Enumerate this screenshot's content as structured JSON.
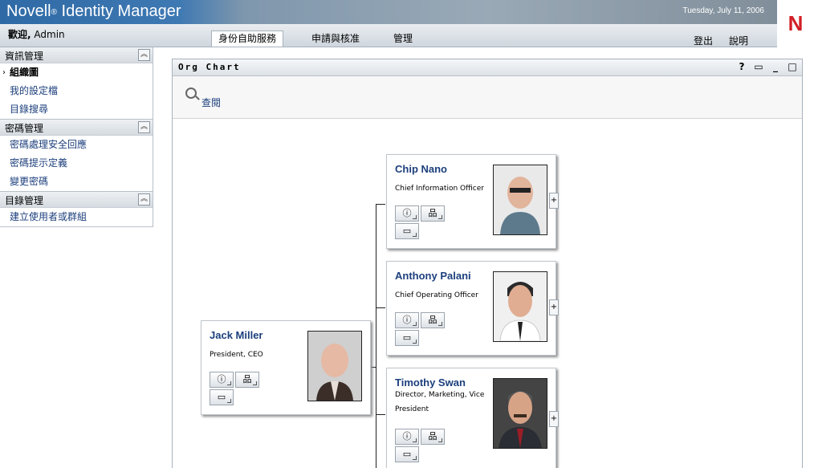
{
  "banner": {
    "brand": "Novell",
    "brand_mark": "®",
    "brand_rest": " Identity Manager",
    "date": "Tuesday, July 11, 2006",
    "logo": "N"
  },
  "header": {
    "welcome_prefix": "歡迎,",
    "welcome_user": "Admin",
    "tabs": [
      {
        "label": "身份自助服務",
        "active": true
      },
      {
        "label": "申請與核准"
      },
      {
        "label": "管理"
      }
    ],
    "logout": "登出",
    "help": "說明"
  },
  "sidebar": {
    "sections": [
      {
        "title": "資訊管理",
        "items": [
          {
            "label": "組織圖",
            "current": true
          },
          {
            "label": "我的設定檔"
          },
          {
            "label": "目錄搜尋"
          }
        ]
      },
      {
        "title": "密碼管理",
        "items": [
          {
            "label": "密碼處理安全回應"
          },
          {
            "label": "密碼提示定義"
          },
          {
            "label": "變更密碼"
          }
        ]
      },
      {
        "title": "目錄管理",
        "items": [
          {
            "label": "建立使用者或群組"
          }
        ]
      }
    ]
  },
  "portlet": {
    "title": "Org Chart",
    "tools": {
      "help": "?",
      "print": "▭",
      "minimize": "_",
      "maximize": "□"
    },
    "view_link": "查閱"
  },
  "people": [
    {
      "name": "Jack Miller",
      "title": "President, CEO"
    },
    {
      "name": "Chip Nano",
      "title": "Chief Information Officer"
    },
    {
      "name": "Anthony Palani",
      "title": "Chief Operating Officer"
    },
    {
      "name": "Timothy Swan",
      "title": "Director, Marketing, Vice President"
    }
  ],
  "icons": {
    "info": "info-icon",
    "org": "org-chart-icon",
    "email": "email-card-icon",
    "expand": "+"
  },
  "colors": {
    "link": "#1c3f7c",
    "banner_blue": "#2f6aa6",
    "novell_red": "#d21f26"
  }
}
